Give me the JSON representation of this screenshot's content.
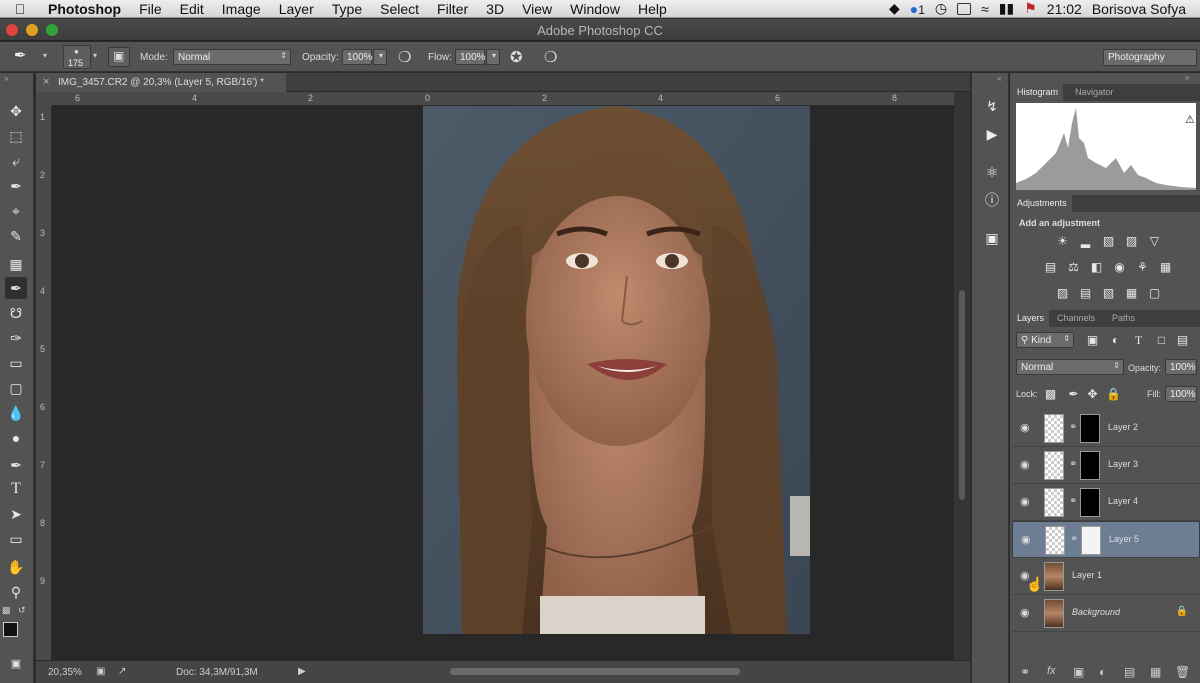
{
  "menubar": {
    "app_name": "Photoshop",
    "items": [
      "File",
      "Edit",
      "Image",
      "Layer",
      "Type",
      "Select",
      "Filter",
      "3D",
      "View",
      "Window",
      "Help"
    ],
    "notification_count": "1",
    "time": "21:02",
    "user": "Borisova Sofya"
  },
  "window": {
    "title": "Adobe Photoshop CC"
  },
  "options": {
    "brush_size": "175",
    "mode_label": "Mode:",
    "mode_value": "Normal",
    "opacity_label": "Opacity:",
    "opacity_value": "100%",
    "flow_label": "Flow:",
    "flow_value": "100%",
    "workspace": "Photography"
  },
  "document": {
    "tab_title": "IMG_3457.CR2 @ 20,3% (Layer 5, RGB/16') *",
    "ruler_top": [
      "6",
      "4",
      "2",
      "0",
      "2",
      "4",
      "6",
      "8"
    ],
    "ruler_left": [
      "1",
      "2",
      "3",
      "4",
      "5",
      "6",
      "7",
      "8",
      "9"
    ]
  },
  "status": {
    "zoom": "20,35%",
    "doc_info": "Doc: 34,3M/91,3M"
  },
  "panels": {
    "top_tabs": [
      "Histogram",
      "Navigator"
    ],
    "adjustments_tab": "Adjustments",
    "add_adjustment": "Add an adjustment",
    "layer_tabs": [
      "Layers",
      "Channels",
      "Paths"
    ],
    "filter_kind": "Kind",
    "blend_mode": "Normal",
    "opacity_label": "Opacity:",
    "opacity_value": "100%",
    "lock_label": "Lock:",
    "fill_label": "Fill:",
    "fill_value": "100%"
  },
  "layers": [
    {
      "name": "Layer 2",
      "selected": false
    },
    {
      "name": "Layer 3",
      "selected": false
    },
    {
      "name": "Layer 4",
      "selected": false
    },
    {
      "name": "Layer 5",
      "selected": true
    },
    {
      "name": "Layer 1",
      "selected": false
    },
    {
      "name": "Background",
      "selected": false
    }
  ],
  "colors": {
    "selected_layer": "#6c7d94",
    "panel_bg": "#535353",
    "canvas_bg": "#282828"
  }
}
